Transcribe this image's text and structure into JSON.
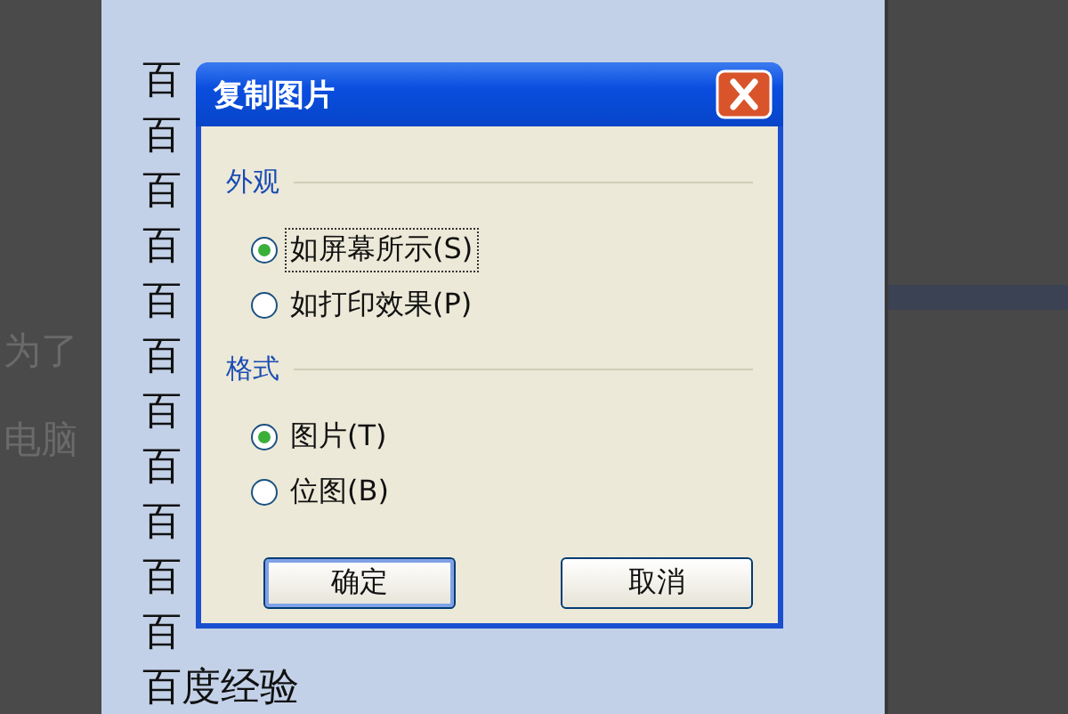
{
  "background_text": [
    "为了",
    "电脑"
  ],
  "document": {
    "lines": [
      "百",
      "百",
      "百",
      "百",
      "百",
      "百",
      "百",
      "百",
      "百",
      "百",
      "百",
      "百度经验"
    ]
  },
  "dialog": {
    "title": "复制图片",
    "groups": [
      {
        "label": "外观",
        "options": [
          {
            "label": "如屏幕所示(S)",
            "selected": true,
            "focused": true
          },
          {
            "label": "如打印效果(P)",
            "selected": false,
            "focused": false
          }
        ]
      },
      {
        "label": "格式",
        "options": [
          {
            "label": "图片(T)",
            "selected": true,
            "focused": false
          },
          {
            "label": "位图(B)",
            "selected": false,
            "focused": false
          }
        ]
      }
    ],
    "buttons": [
      {
        "label": "确定",
        "default": true
      },
      {
        "label": "取消",
        "default": false
      }
    ]
  }
}
